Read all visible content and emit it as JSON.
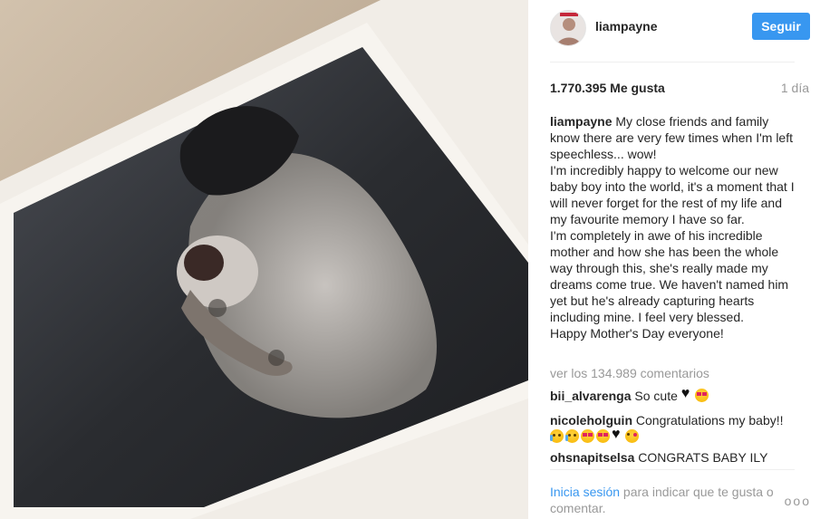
{
  "post": {
    "username": "liampayne",
    "follow_label": "Seguir",
    "likes": "1.770.395 Me gusta",
    "time": "1 día",
    "caption_user": "liampayne",
    "caption_lines": [
      " My close friends and family know there are very few times when I'm left speechless... wow!",
      "I'm incredibly happy to welcome our new baby boy into the world, it's a moment that I will never forget for the rest of my life and my favourite memory I have so far.",
      "I'm completely in awe of his incredible mother and how she has been the whole way through this, she's really made my dreams come true. We haven't named him yet but he's already capturing hearts including mine. I feel very blessed.",
      "Happy Mother's Day everyone!"
    ],
    "view_all": "ver los 134.989 comentarios"
  },
  "comments": [
    {
      "user": "bii_alvarenga",
      "text": " So cute ",
      "emojis": [
        "black-heart",
        "heart-eyes-face"
      ]
    },
    {
      "user": "nicoleholguin",
      "text": " Congratulations my baby!!",
      "emojis": [
        "crying-face",
        "crying-face",
        "heart-eyes-face",
        "heart-eyes-face",
        "black-heart",
        "kissing-face"
      ]
    },
    {
      "user": "ohsnapitselsa",
      "text": " CONGRATS BABY ILY",
      "emojis": []
    }
  ],
  "login": {
    "link": "Inicia sesión",
    "rest": " para indicar que te gusta o comentar."
  },
  "more_label": "ooo",
  "colors": {
    "accent": "#3897f0",
    "muted": "#999999",
    "text": "#262626"
  }
}
